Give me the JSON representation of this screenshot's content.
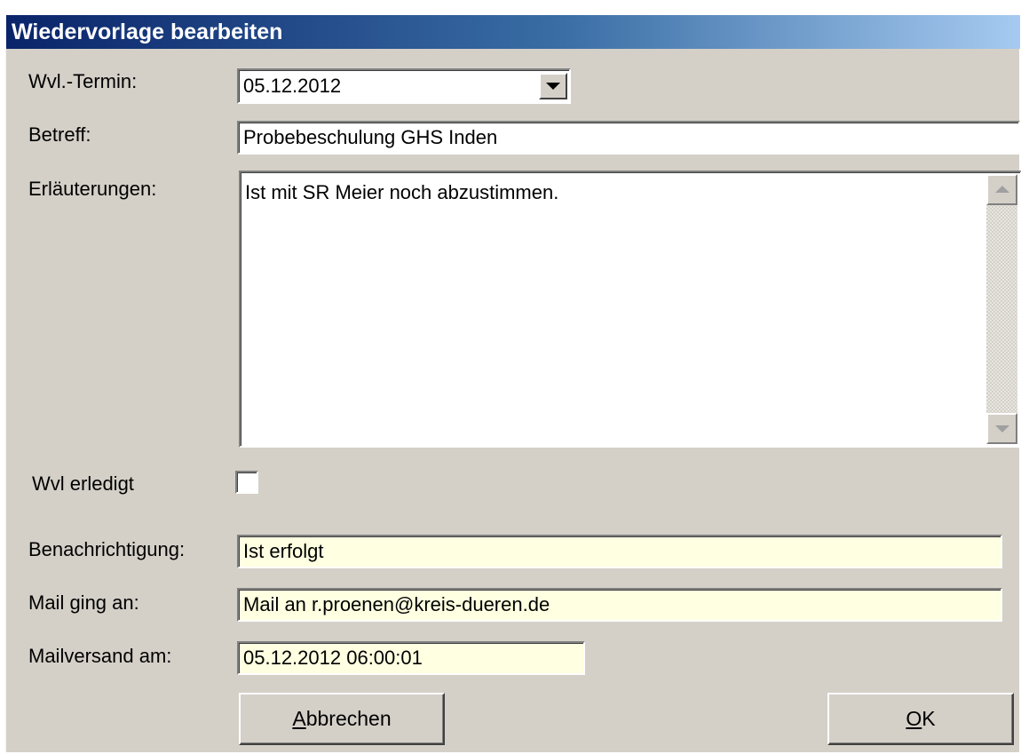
{
  "window": {
    "title": "Wiedervorlage bearbeiten"
  },
  "form": {
    "termin": {
      "label": "Wvl.-Termin:",
      "value": "05.12.2012"
    },
    "betreff": {
      "label": "Betreff:",
      "value": "Probebeschulung GHS Inden"
    },
    "erlaeuterungen": {
      "label": "Erläuterungen:",
      "value": "Ist mit SR Meier noch abzustimmen."
    },
    "erledigt": {
      "label": "Wvl erledigt",
      "checked": false
    },
    "benachrichtigung": {
      "label": "Benachrichtigung:",
      "value": "Ist erfolgt"
    },
    "mail_an": {
      "label": "Mail ging an:",
      "value": "Mail an r.proenen@kreis-dueren.de"
    },
    "mailversand": {
      "label": "Mailversand am:",
      "value": "05.12.2012 06:00:01"
    }
  },
  "buttons": {
    "cancel": "Abbrechen",
    "ok": "OK"
  },
  "icons": {
    "dropdown": "chevron-down-icon",
    "scroll_up": "scroll-up-arrow-icon",
    "scroll_down": "scroll-down-arrow-icon"
  },
  "colors": {
    "title_gradient_start": "#0a246a",
    "title_gradient_end": "#a6caf0",
    "dialog_bg": "#d4d0c8",
    "readonly_field_bg": "#ffffe1"
  }
}
